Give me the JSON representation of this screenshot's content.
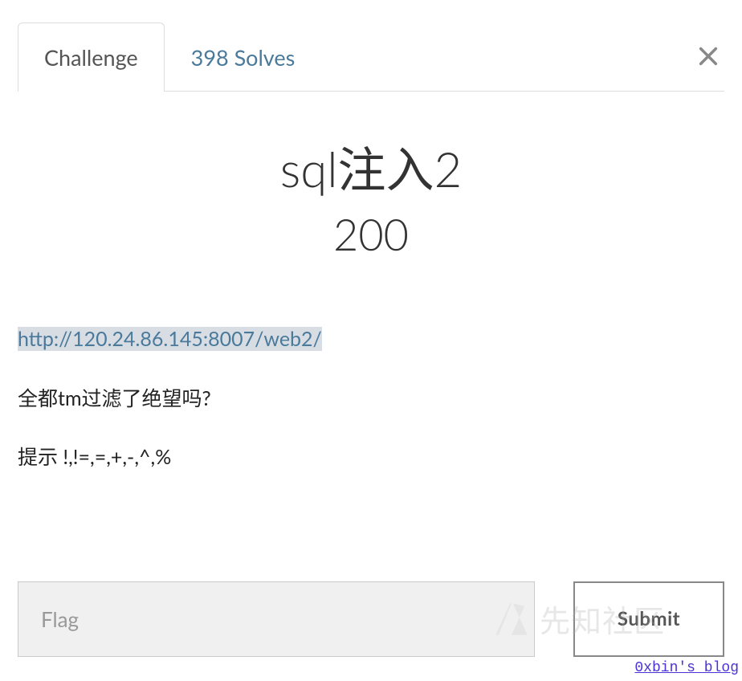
{
  "tabs": {
    "challenge": "Challenge",
    "solves": "398 Solves"
  },
  "challenge": {
    "title": "sql注入2",
    "points": "200",
    "link": "http://120.24.86.145:8007/web2/",
    "desc1": "全都tm过滤了绝望吗?",
    "desc2": "提示 !,!=,=,+,-,^,%"
  },
  "form": {
    "placeholder": "Flag",
    "submit_label": "Submit"
  },
  "watermark": {
    "text": "先知社区"
  },
  "footer": {
    "blog_link": "0xbin's blog"
  }
}
